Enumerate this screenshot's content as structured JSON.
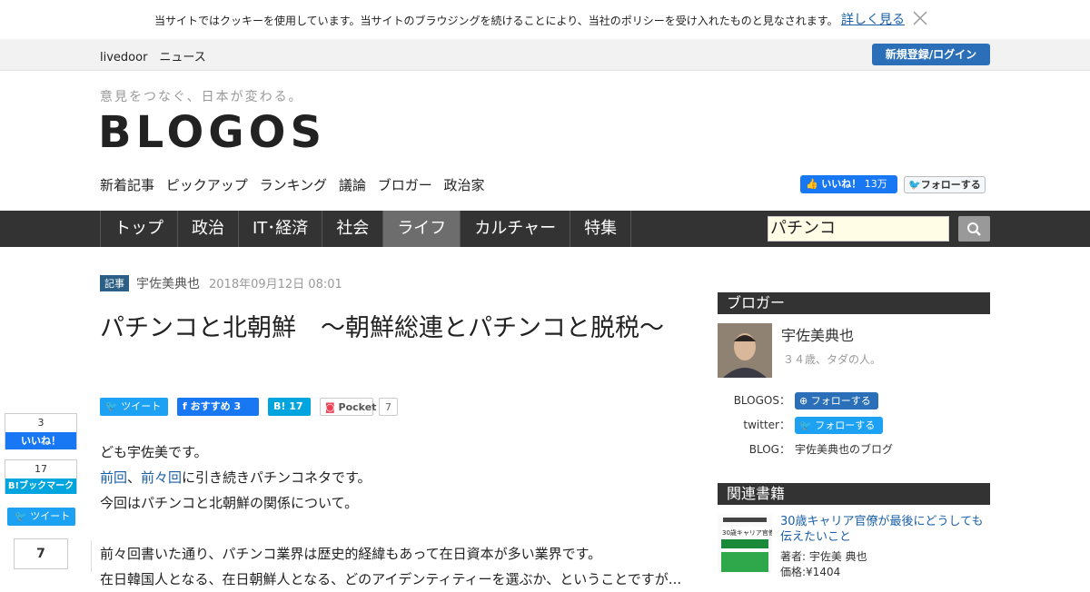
{
  "cookie": {
    "text": "当サイトではクッキーを使用しています。当サイトのブラウジングを続けることにより、当社のポリシーを受け入れたものと見なされます。",
    "more": "詳しく見る"
  },
  "topbar": {
    "brand": "livedoor　ニュース",
    "login": "新規登録/ログイン"
  },
  "header": {
    "tagline": "意見をつなぐ、日本が変わる。",
    "logo": "BLOGOS"
  },
  "subnav": [
    "新着記事",
    "ピックアップ",
    "ランキング",
    "議論",
    "ブロガー",
    "政治家"
  ],
  "social_top": {
    "fb_label": "いいね！",
    "fb_count": "13万",
    "tw_label": "フォローする"
  },
  "mainnav": {
    "items": [
      "トップ",
      "政治",
      "IT･経済",
      "社会",
      "ライフ",
      "カルチャー",
      "特集"
    ],
    "active": "ライフ",
    "search_value": "パチンコ"
  },
  "article": {
    "badge": "記事",
    "author": "宇佐美典也",
    "date": "2018年09月12日 08:01",
    "title": "パチンコと北朝鮮　〜朝鮮総連とパチンコと脱税〜",
    "share": {
      "tweet": "ツイート",
      "fb": "おすすめ 3",
      "hatena": "17",
      "pocket": "Pocket",
      "pocket_count": "7"
    },
    "body": {
      "line1": "ども宇佐美です。",
      "link1": "前回",
      "sep": "、",
      "link2": "前々回",
      "line2_rest": "に引き続きパチンコネタです。",
      "line3": "今回はパチンコと北朝鮮の関係について。",
      "line4": "前々回書いた通り、パチンコ業界は歴史的経緯もあって在日資本が多い業界です。",
      "line5": "在日韓国人となる、在日朝鮮人となる、どのアイデンティティーを選ぶか、ということですが..."
    }
  },
  "side_share": {
    "fb_count": "3",
    "fb_label": "いいね！",
    "hb_count": "17",
    "hb_label": "B!ブックマーク",
    "tw_label": "ツイート",
    "pocket_count": "7"
  },
  "sidebar": {
    "blogger_heading": "ブロガー",
    "blogger_name": "宇佐美典也",
    "blogger_desc": "３４歳、タダの人。",
    "blogos_label": "BLOGOS：",
    "blogos_follow": "フォローする",
    "twitter_label": "twitter：",
    "twitter_follow": "フォローする",
    "blog_label": "BLOG：",
    "blog_link": "宇佐美典也のブログ",
    "books_heading": "関連書籍",
    "book_title": "30歳キャリア官僚が最後にどうしても伝えたいこと",
    "book_author": "著者: 宇佐美 典也",
    "book_price": "価格:¥1404",
    "book_cover_text": "30歳キャリア官僚が"
  },
  "colors": {
    "accent": "#2a6fb8",
    "nav_bg": "#333333",
    "nav_active": "#6d6d6d",
    "link": "#1a5fa8"
  }
}
